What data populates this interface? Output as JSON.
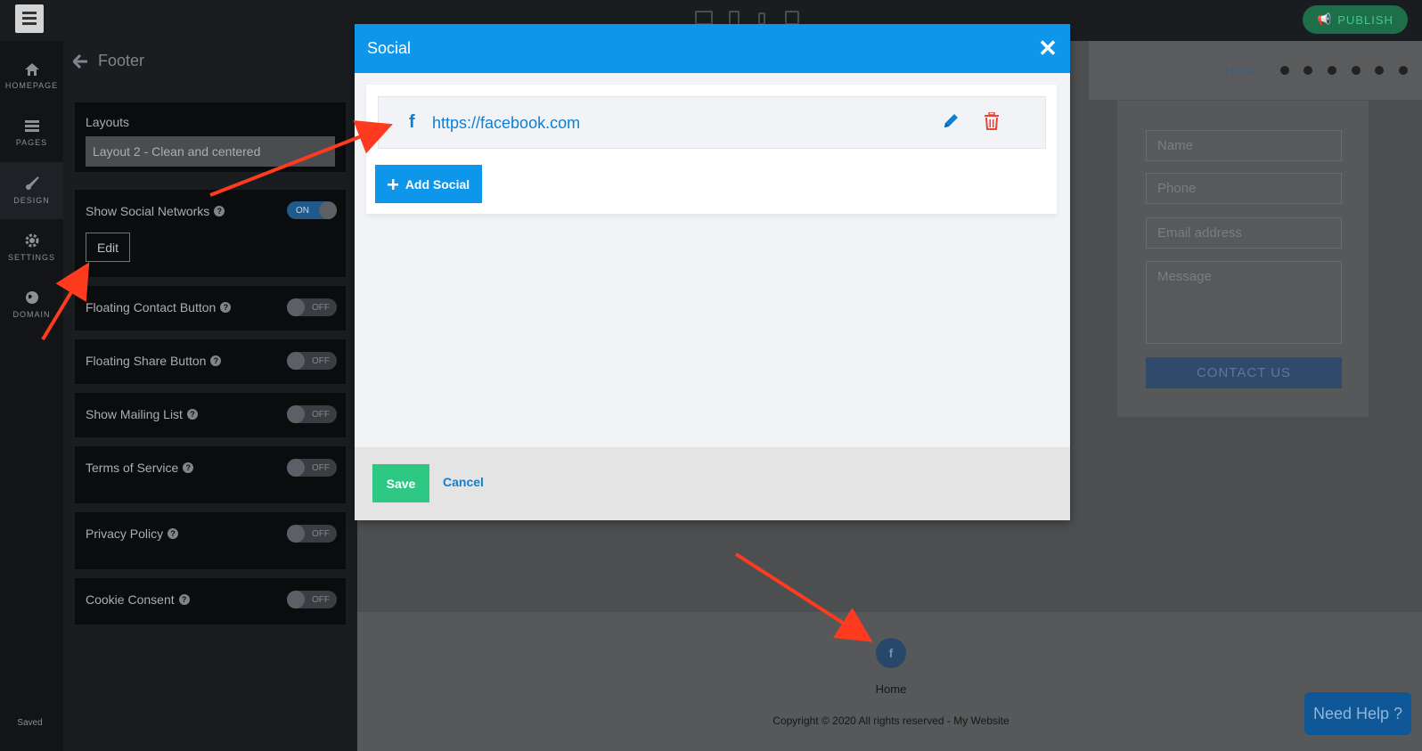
{
  "topbar": {
    "publish_label": "PUBLISH"
  },
  "rail": {
    "items": [
      {
        "label": "HOMEPAGE",
        "icon": "home-icon"
      },
      {
        "label": "PAGES",
        "icon": "pages-icon"
      },
      {
        "label": "DESIGN",
        "icon": "brush-icon"
      },
      {
        "label": "SETTINGS",
        "icon": "gear-icon"
      },
      {
        "label": "DOMAIN",
        "icon": "globe-icon"
      }
    ],
    "status": "Saved"
  },
  "panel": {
    "title": "Footer",
    "layouts_label": "Layouts",
    "layout_value": "Layout 2 - Clean and centered",
    "settings": [
      {
        "label": "Show Social Networks",
        "state": "ON"
      },
      {
        "label": "Floating Contact Button",
        "state": "OFF"
      },
      {
        "label": "Floating Share Button",
        "state": "OFF"
      },
      {
        "label": "Show Mailing List",
        "state": "OFF"
      },
      {
        "label": "Terms of Service",
        "state": "OFF"
      },
      {
        "label": "Privacy Policy",
        "state": "OFF"
      },
      {
        "label": "Cookie Consent",
        "state": "OFF"
      }
    ],
    "edit_label": "Edit"
  },
  "preview": {
    "nav_home": "HOME",
    "form": {
      "name_placeholder": "Name",
      "phone_placeholder": "Phone",
      "email_placeholder": "Email address",
      "message_placeholder": "Message",
      "submit_label": "CONTACT US"
    },
    "footer_home": "Home",
    "copyright": "Copyright © 2020 All rights reserved - My Website",
    "need_help": "Need Help ?"
  },
  "modal": {
    "title": "Social",
    "close": "✕",
    "social_items": [
      {
        "network": "facebook",
        "glyph": "f",
        "url": "https://facebook.com"
      }
    ],
    "add_label": "Add Social",
    "save_label": "Save",
    "cancel_label": "Cancel"
  },
  "colors": {
    "accent": "#0e97ea",
    "save": "#2ec784",
    "danger": "#e04a3a",
    "arrow": "#ff3b1f"
  }
}
